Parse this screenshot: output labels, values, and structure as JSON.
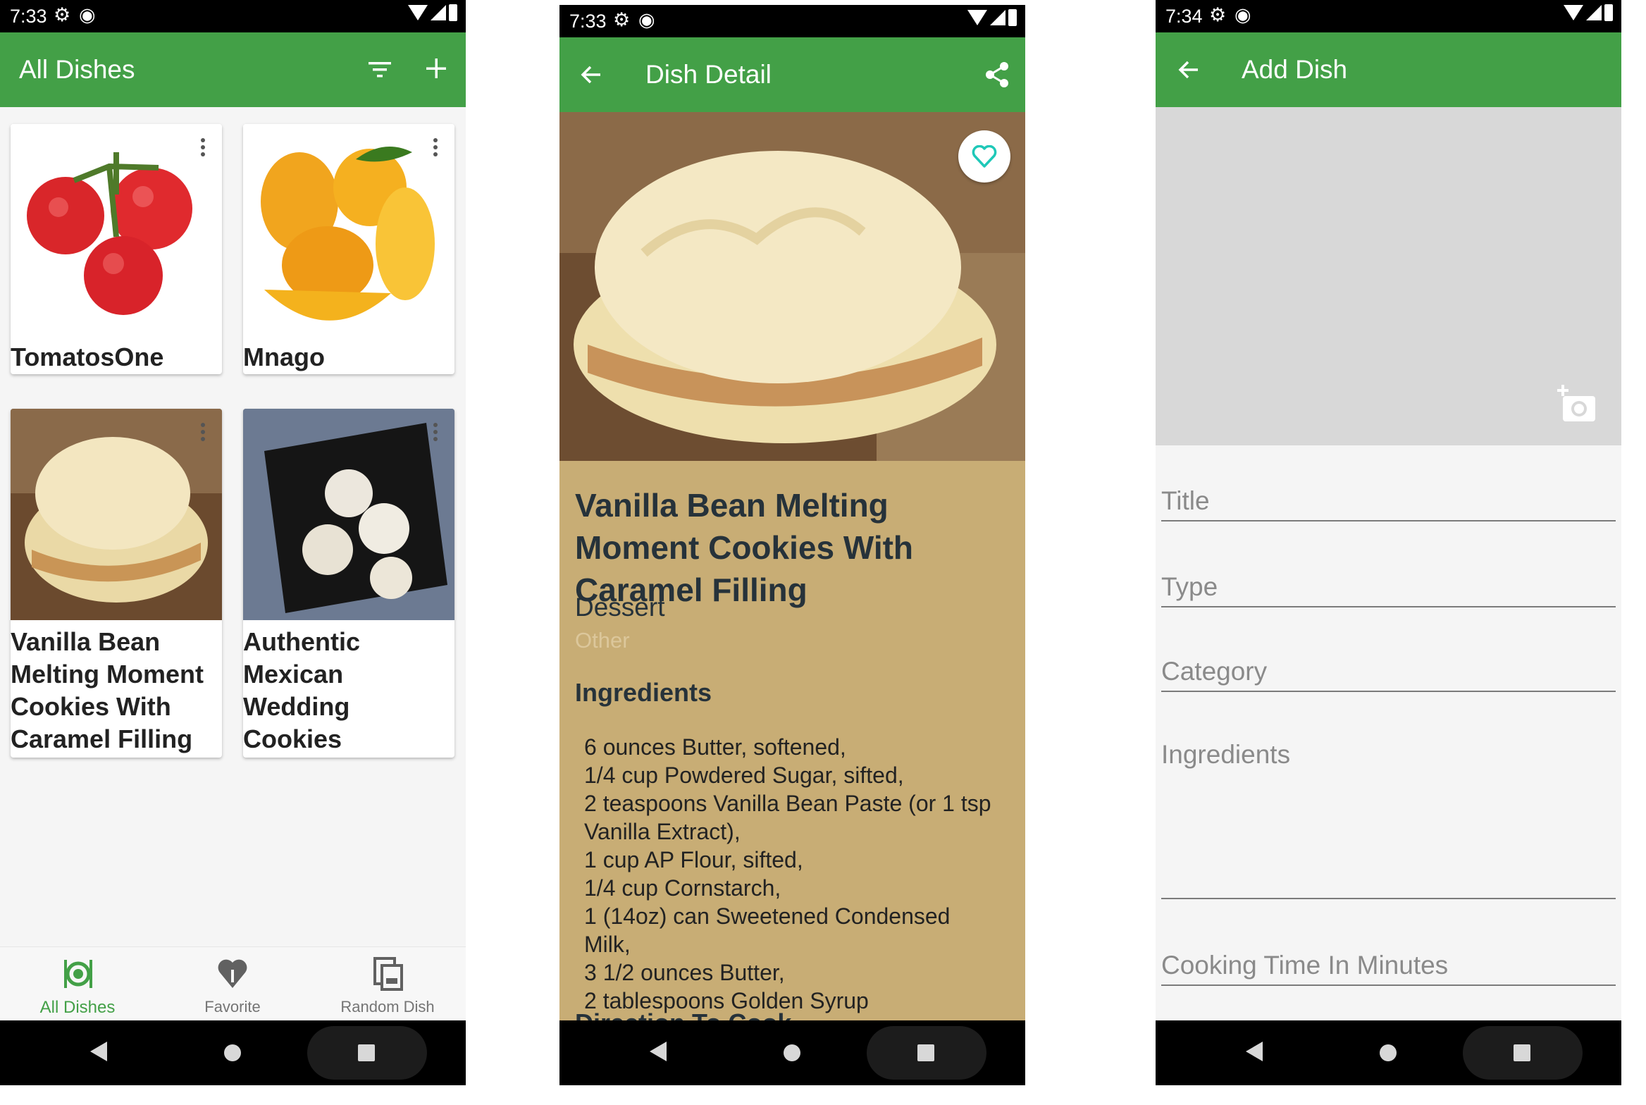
{
  "screens": {
    "list": {
      "status_time": "7:33",
      "title": "All Dishes",
      "dishes": [
        {
          "title": "TomatosOne"
        },
        {
          "title": "Mnago"
        },
        {
          "title": "Vanilla Bean Melting Moment Cookies With Caramel Filling"
        },
        {
          "title": "Authentic Mexican Wedding Cookies"
        }
      ],
      "bottom_nav": [
        {
          "label": "All Dishes",
          "icon": "dish-icon",
          "active": true
        },
        {
          "label": "Favorite",
          "icon": "heart-icon",
          "active": false
        },
        {
          "label": "Random Dish",
          "icon": "random-dish-icon",
          "active": false
        }
      ]
    },
    "detail": {
      "status_time": "7:33",
      "title": "Dish Detail",
      "dish_title": "Vanilla Bean Melting Moment Cookies With Caramel Filling",
      "type": "Dessert",
      "category": "Other",
      "ingredients_heading": "Ingredients",
      "ingredients": "6 ounces Butter, softened,\n1/4 cup Powdered Sugar, sifted,\n2 teaspoons Vanilla Bean Paste (or 1 tsp Vanilla Extract),\n1 cup AP Flour, sifted,\n1/4 cup Cornstarch,\n1 (14oz) can Sweetened Condensed Milk,\n3 1/2 ounces Butter,\n2 tablespoons Golden Syrup",
      "direction_heading": "Direction To Cook"
    },
    "add": {
      "status_time": "7:34",
      "title": "Add Dish",
      "fields": {
        "title": "Title",
        "type": "Type",
        "category": "Category",
        "ingredients": "Ingredients",
        "cooking_time": "Cooking Time In Minutes"
      }
    }
  },
  "colors": {
    "primary": "#43a047",
    "detail_background": "#c8ad75",
    "accent": "#1fc8b8"
  }
}
